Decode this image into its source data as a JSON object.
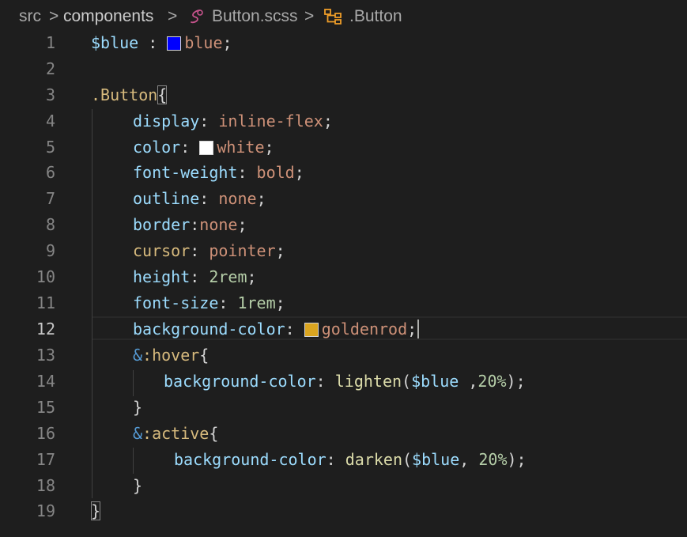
{
  "breadcrumb": {
    "items": [
      "src",
      "components",
      "Button.scss",
      ".Button"
    ],
    "separator": ">",
    "file_icon": "scss-file-icon",
    "symbol_icon": "class-symbol-icon"
  },
  "editor": {
    "language": "scss",
    "current_line": "12",
    "line_numbers": [
      "1",
      "2",
      "3",
      "4",
      "5",
      "6",
      "7",
      "8",
      "9",
      "10",
      "11",
      "12",
      "13",
      "14",
      "15",
      "16",
      "17",
      "18",
      "19"
    ],
    "lines": {
      "l1": {
        "var": "$blue",
        "colon": " : ",
        "val": "blue",
        "semi": ";",
        "swatch_color": "#0000ff"
      },
      "l3": {
        "selector": ".Button",
        "brace": "{"
      },
      "l4": {
        "prop": "display",
        "colon": ": ",
        "val": "inline-flex",
        "semi": ";"
      },
      "l5": {
        "prop": "color",
        "colon": ": ",
        "val": "white",
        "semi": ";",
        "swatch_color": "#ffffff"
      },
      "l6": {
        "prop": "font-weight",
        "colon": ": ",
        "val": "bold",
        "semi": ";"
      },
      "l7": {
        "prop": "outline",
        "colon": ": ",
        "val": "none",
        "semi": ";"
      },
      "l8": {
        "prop": "border",
        "colon": ":",
        "val": "none",
        "semi": ";"
      },
      "l9": {
        "prop": "cursor",
        "colon": ": ",
        "val": "pointer",
        "semi": ";"
      },
      "l10": {
        "prop": "height",
        "colon": ": ",
        "val": "2rem",
        "semi": ";"
      },
      "l11": {
        "prop": "font-size",
        "colon": ": ",
        "val": "1rem",
        "semi": ";"
      },
      "l12": {
        "prop": "background-color",
        "colon": ": ",
        "val": "goldenrod",
        "semi": ";",
        "swatch_color": "#daa520"
      },
      "l13": {
        "amp": "&",
        "selector": ":hover",
        "brace": "{"
      },
      "l14": {
        "prop": "background-color",
        "colon": ": ",
        "fn": "lighten",
        "open": "(",
        "arg_var": "$blue",
        "mid": " ,",
        "arg_num": "20%",
        "close": ");"
      },
      "l15": {
        "brace": "}"
      },
      "l16": {
        "amp": "&",
        "selector": ":active",
        "brace": "{"
      },
      "l17": {
        "prop": "background-color",
        "colon": ": ",
        "fn": "darken",
        "open": "(",
        "arg_var": "$blue",
        "mid": ", ",
        "arg_num": "20%",
        "close": ");"
      },
      "l18": {
        "brace": "}"
      },
      "l19": {
        "brace": "}"
      }
    }
  },
  "theme": {
    "background": "#1e1e1e",
    "line_number": "#858585",
    "property": "#9cdcfe",
    "value": "#ce9178",
    "number": "#b5cea8",
    "selector": "#d7ba7d",
    "function": "#dcdcaa",
    "ampersand": "#569cd6"
  }
}
